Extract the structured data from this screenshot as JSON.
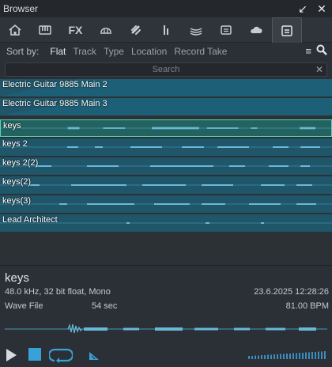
{
  "window": {
    "title": "Browser",
    "minimize_icon": "collapse-arrow-icon",
    "close_icon": "close-icon"
  },
  "tabs": [
    {
      "id": "home",
      "icon": "home-icon"
    },
    {
      "id": "instruments",
      "icon": "keyboard-icon"
    },
    {
      "id": "fx",
      "label": "FX"
    },
    {
      "id": "loops",
      "icon": "loop-icon"
    },
    {
      "id": "pool",
      "icon": "link-icon"
    },
    {
      "id": "cloud-files",
      "icon": "io-icon"
    },
    {
      "id": "sounds",
      "icon": "layers-icon"
    },
    {
      "id": "files",
      "icon": "folder-icon"
    },
    {
      "id": "cloud",
      "icon": "cloud-icon"
    },
    {
      "id": "pool-files",
      "icon": "tray-icon",
      "active": true
    }
  ],
  "sort": {
    "label": "Sort by:",
    "options": [
      "Flat",
      "Track",
      "Type",
      "Location",
      "Record Take"
    ],
    "active": "Flat"
  },
  "search": {
    "placeholder": "Search",
    "value": ""
  },
  "files": [
    {
      "name": "Electric Guitar 9885 Main 2",
      "selected": false
    },
    {
      "name": "Electric Guitar 9885 Main 3",
      "selected": false
    },
    {
      "name": "keys",
      "selected": true
    },
    {
      "name": "keys 2",
      "selected": false
    },
    {
      "name": "keys 2(2)",
      "selected": false
    },
    {
      "name": "keys(2)",
      "selected": false
    },
    {
      "name": "keys(3)",
      "selected": false
    },
    {
      "name": "Lead Architect",
      "selected": false
    }
  ],
  "info": {
    "filename": "keys",
    "format": "48.0 kHz, 32 bit float, Mono",
    "date": "23.6.2025 12:28:26",
    "type": "Wave File",
    "duration": "54 sec",
    "tempo": "81.00 BPM"
  },
  "colors": {
    "row_bg": "#20566a",
    "row_selected_border": "#5fd1b8",
    "wave": "#5fb0d0",
    "accent": "#3aa0d8"
  }
}
